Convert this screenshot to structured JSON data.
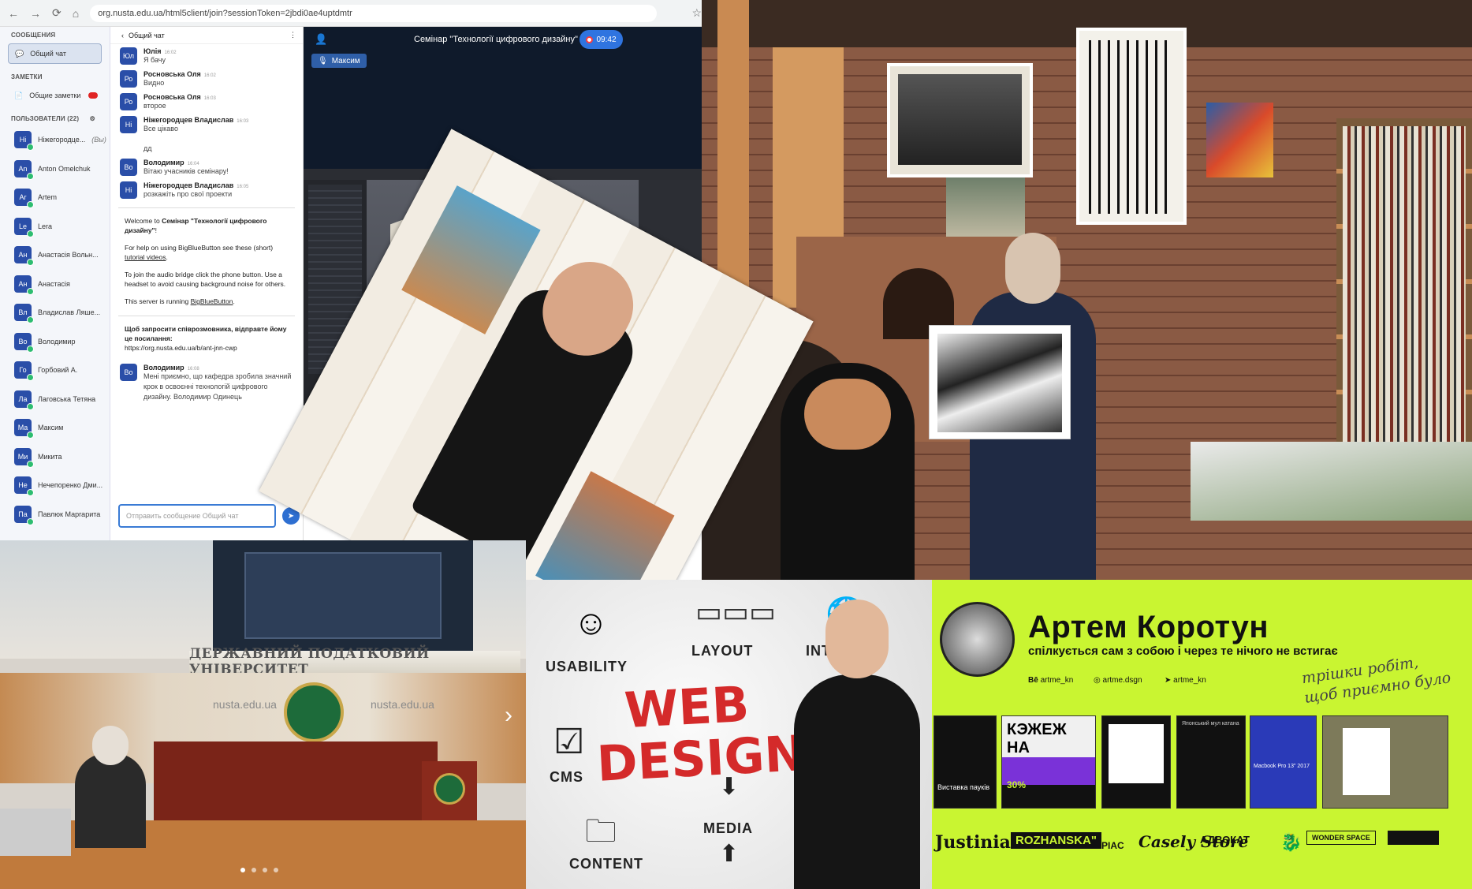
{
  "browser": {
    "url": "org.nusta.edu.ua/html5client/join?sessionToken=2jbdi0ae4uptdmtr"
  },
  "sidebar": {
    "messages_header": "СООБЩЕНИЯ",
    "public_chat": "Общий чат",
    "notes_header": "ЗАМЕТКИ",
    "shared_notes": "Общие заметки",
    "users_header": "ПОЛЬЗОВАТЕЛИ (22)",
    "users": [
      {
        "initials": "Ні",
        "name": "Ніжегородце...",
        "tag": "(Вы)"
      },
      {
        "initials": "An",
        "name": "Anton Omelchuk",
        "tag": ""
      },
      {
        "initials": "Ar",
        "name": "Artem",
        "tag": ""
      },
      {
        "initials": "Le",
        "name": "Lera",
        "tag": ""
      },
      {
        "initials": "Ан",
        "name": "Анастасія Вольн...",
        "tag": ""
      },
      {
        "initials": "Ан",
        "name": "Анастасія",
        "tag": ""
      },
      {
        "initials": "Вл",
        "name": "Владислав Ляше...",
        "tag": ""
      },
      {
        "initials": "Во",
        "name": "Володимир",
        "tag": ""
      },
      {
        "initials": "Го",
        "name": "Горбовий А.",
        "tag": ""
      },
      {
        "initials": "Ла",
        "name": "Лаговська Тетяна",
        "tag": ""
      },
      {
        "initials": "Ма",
        "name": "Максим",
        "tag": ""
      },
      {
        "initials": "Ми",
        "name": "Микита",
        "tag": ""
      },
      {
        "initials": "Не",
        "name": "Нечепоренко Дми...",
        "tag": ""
      },
      {
        "initials": "Па",
        "name": "Павлюк Маргарита",
        "tag": ""
      }
    ]
  },
  "chat": {
    "title": "Общий чат",
    "messages": [
      {
        "initials": "Юл",
        "who": "Юлія",
        "time": "16:02",
        "text": "Я бачу"
      },
      {
        "initials": "Ро",
        "who": "Росновська Оля",
        "time": "16:02",
        "text": "Видно"
      },
      {
        "initials": "Ро",
        "who": "Росновська Оля",
        "time": "16:03",
        "text": "второе"
      },
      {
        "initials": "Ні",
        "who": "Ніжегородцев Владислав",
        "time": "16:03",
        "text": "Все цікаво"
      },
      {
        "initials": "",
        "who": "",
        "time": "",
        "text": "дд"
      },
      {
        "initials": "Во",
        "who": "Володимир",
        "time": "16:04",
        "text": "Вітаю учасників семінару!"
      },
      {
        "initials": "Ні",
        "who": "Ніжегородцев Владислав",
        "time": "16:05",
        "text": "розкажіть про свої проекти"
      }
    ],
    "welcome_prefix": "Welcome to ",
    "welcome_title": "Семінар \"Технології цифрового дизайну\"",
    "welcome_suffix": "!",
    "help_prefix": "For help on using BigBlueButton see these (short) ",
    "help_link": "tutorial videos",
    "audio_text": "To join the audio bridge click the phone button. Use a headset to avoid causing background noise for others.",
    "running_prefix": "This server is running ",
    "running_link": "BigBlueButton",
    "invite_text": "Щоб запросити співрозмовника, відправте йому це посилання:",
    "invite_link": "https://org.nusta.edu.ua/b/ant-jnn-cwp",
    "last_msg": {
      "initials": "Во",
      "who": "Володимир",
      "time": "16:08",
      "text": "Мені приємно, що кафедра зробила значний крок в освоєнні технологій цифрового дизайну. Володимир Одинець"
    },
    "input_placeholder": "Отправить сообщение Общий чат"
  },
  "meeting": {
    "title": "Семінар \"Технології цифрового дизайну\"",
    "timer": "09:42",
    "talker": "Максим"
  },
  "auditorium": {
    "banner": "ДЕРЖАВНИЙ ПОДАТКОВИЙ УНІВЕРСИТЕТ",
    "wall_text_left": "nusta.edu.ua",
    "wall_text_right": "nusta.edu.ua"
  },
  "webdesign": {
    "usability": "USABILITY",
    "layout": "LAYOUT",
    "internet": "INTERNET",
    "cms": "CMS",
    "content": "CONTENT",
    "media": "MEDIA",
    "web": "WEB",
    "design": "DESIGN"
  },
  "portfolio": {
    "name": "Артем Коротун",
    "tagline": "спілкується сам з собою і через те нічого не встигає",
    "behance": "artme_kn",
    "instagram": "artme.dsgn",
    "telegram": "artme_kn",
    "handwritten": "трішки робіт, щоб приємно було",
    "tile1_caption": "Виставка пауків",
    "tile2_text": "КЭЖЕЖ НА",
    "tile2_promo": "30%",
    "tile4_text": "Японський мул катана",
    "tile5_text": "Macbook Pro 13\" 2017",
    "logos": [
      "Justinian",
      "ROZHANSKA\"",
      "PIAC",
      "Casely Store",
      "АДВОКАТ",
      "WONDER SPACE"
    ]
  },
  "colors": {
    "portfolio_bg": "#c9f531",
    "web_red": "#d42a2a",
    "bbb_blue": "#2f74e0"
  }
}
